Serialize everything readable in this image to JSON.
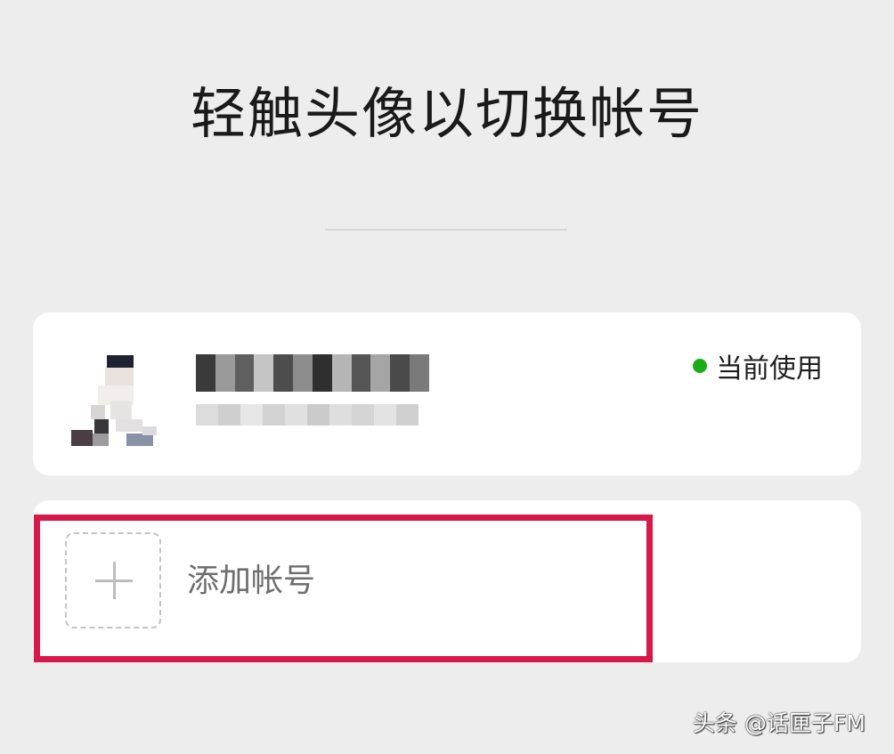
{
  "header": {
    "title": "轻触头像以切换帐号"
  },
  "current_account": {
    "status_label": "当前使用",
    "status_color": "#1aad19"
  },
  "add_account": {
    "label": "添加帐号"
  },
  "highlight": {
    "color": "#d8174a"
  },
  "watermark": {
    "text": "头条 @话匣子FM"
  },
  "icons": {
    "avatar": "avatar-icon",
    "add": "plus-icon",
    "status": "green-dot-icon"
  }
}
